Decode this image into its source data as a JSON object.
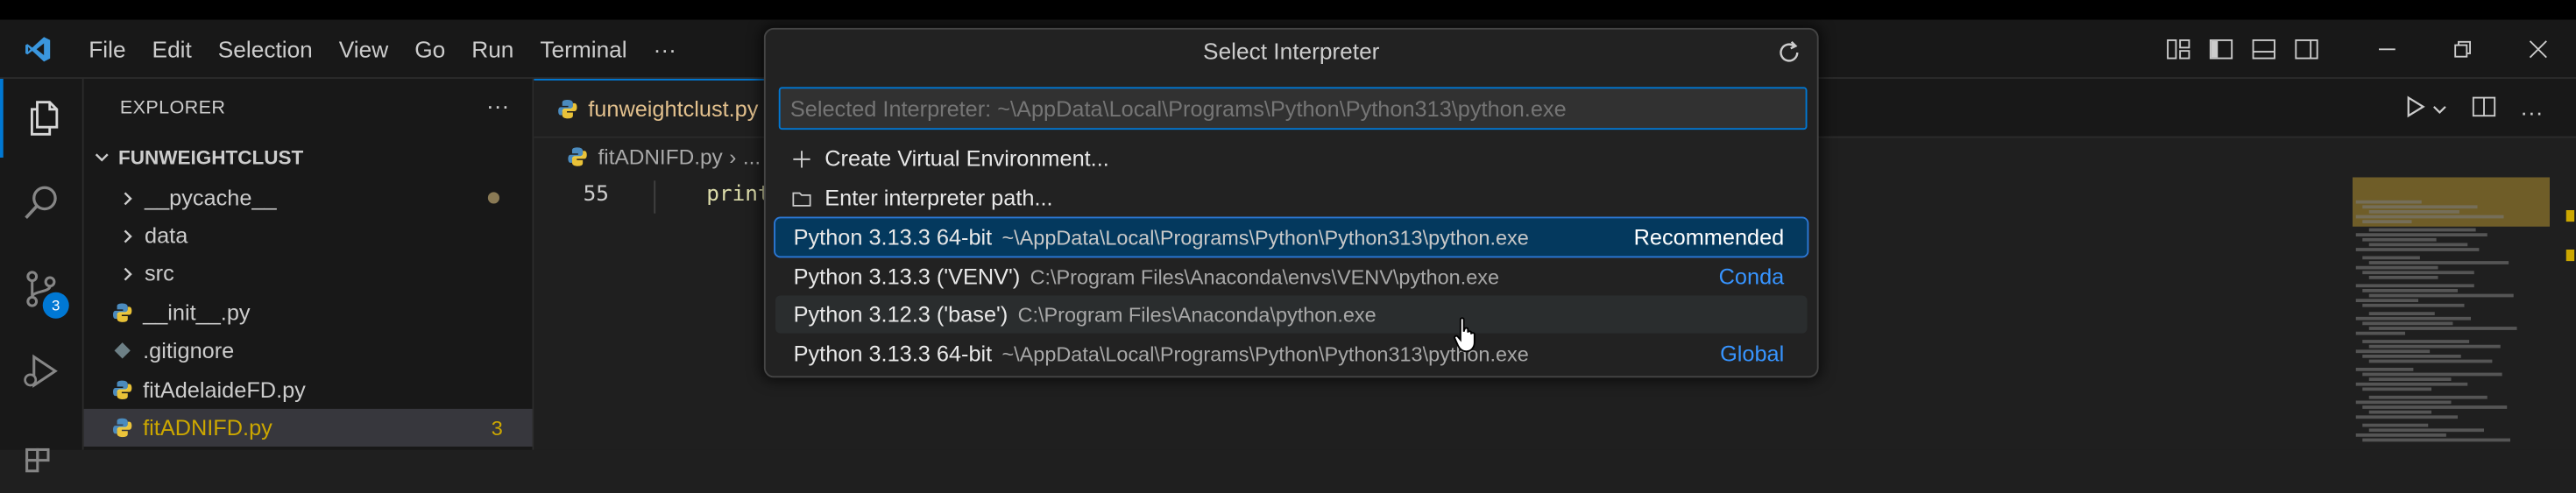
{
  "menu": [
    "File",
    "Edit",
    "Selection",
    "View",
    "Go",
    "Run",
    "Terminal",
    "···"
  ],
  "sidebar": {
    "title": "EXPLORER",
    "more": "···",
    "section": "FUNWEIGHTCLUST",
    "items": [
      {
        "label": "__pycache__",
        "kind": "folder"
      },
      {
        "label": "data",
        "kind": "folder"
      },
      {
        "label": "src",
        "kind": "folder"
      },
      {
        "label": "__init__.py",
        "kind": "python"
      },
      {
        "label": ".gitignore",
        "kind": "gitignore"
      },
      {
        "label": "fitAdelaideFD.py",
        "kind": "python"
      },
      {
        "label": "fitADNIFD.py",
        "kind": "python",
        "problems": "3"
      }
    ]
  },
  "scm_badge": "3",
  "editor": {
    "tab_label": "funweightclust.py",
    "breadcrumb": [
      "fitADNIFD.py",
      "›",
      "..."
    ],
    "line_number": "55",
    "code_text": "print"
  },
  "quickpick": {
    "title": "Select Interpreter",
    "input_value": "",
    "input_placeholder": "Selected Interpreter: ~\\AppData\\Local\\Programs\\Python\\Python313\\python.exe",
    "actions": [
      {
        "label": "Create Virtual Environment...",
        "icon": "plus-icon"
      },
      {
        "label": "Enter interpreter path...",
        "icon": "folder-icon"
      }
    ],
    "interpreters": [
      {
        "label": "Python 3.13.3 64-bit",
        "path": "~\\AppData\\Local\\Programs\\Python\\Python313\\python.exe",
        "tag": "Recommended",
        "state": "focused"
      },
      {
        "label": "Python 3.13.3 ('VENV')",
        "path": "C:\\Program Files\\Anaconda\\envs\\VENV\\python.exe",
        "tag": "Conda",
        "state": "normal"
      },
      {
        "label": "Python 3.12.3 ('base')",
        "path": "C:\\Program Files\\Anaconda\\python.exe",
        "tag": "",
        "state": "hover"
      },
      {
        "label": "Python 3.13.3 64-bit",
        "path": "~\\AppData\\Local\\Programs\\Python\\Python313\\python.exe",
        "tag": "Global",
        "state": "normal"
      }
    ]
  },
  "colors": {
    "accent": "#0078d4",
    "focus_row": "#04395e",
    "link_tag": "#3794ff",
    "modified": "#e2c08d",
    "warning": "#cca700"
  }
}
